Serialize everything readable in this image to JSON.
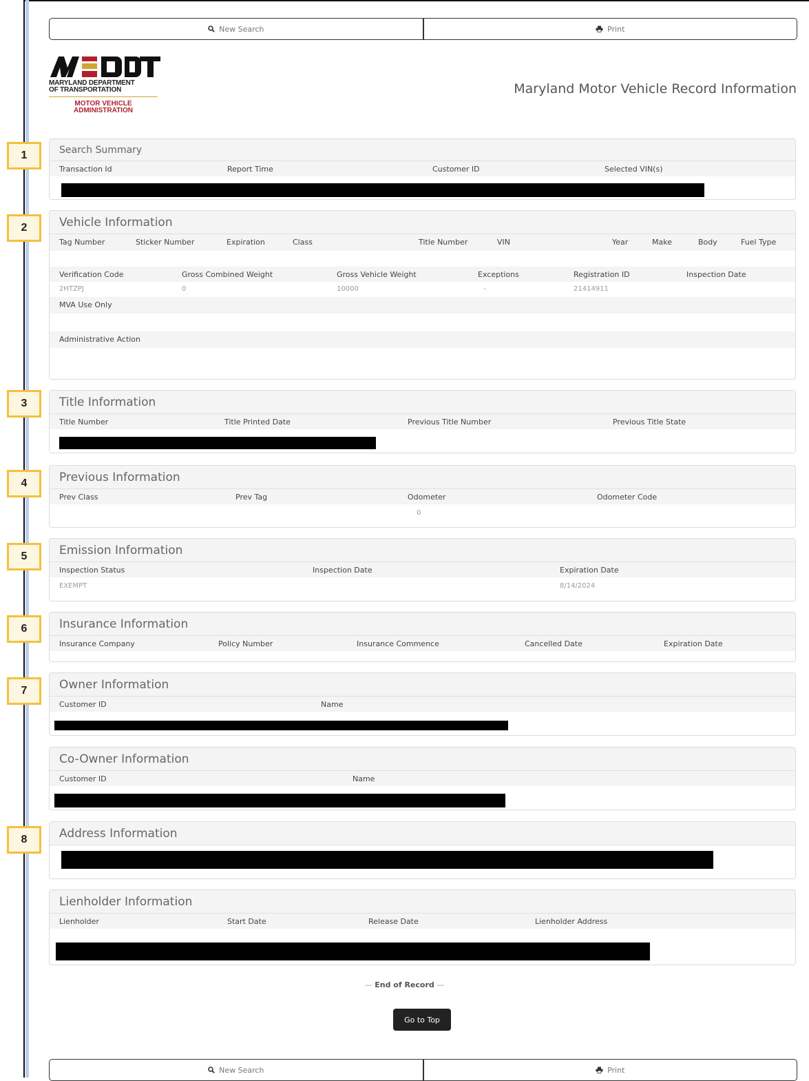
{
  "toolbar": {
    "new_search": "New Search",
    "print": "Print"
  },
  "logo": {
    "mark": "MDOT",
    "dept_line1": "MARYLAND DEPARTMENT",
    "dept_line2": "OF TRANSPORTATION",
    "mva_line1": "MOTOR VEHICLE",
    "mva_line2": "ADMINISTRATION"
  },
  "page_title": "Maryland Motor Vehicle Record Information",
  "badges": [
    "1",
    "2",
    "3",
    "4",
    "5",
    "6",
    "7",
    "8"
  ],
  "search_summary": {
    "title": "Search Summary",
    "headers": [
      "Transaction Id",
      "Report Time",
      "Customer ID",
      "Selected VIN(s)"
    ]
  },
  "vehicle": {
    "title": "Vehicle Information",
    "headers1": [
      "Tag Number",
      "Sticker Number",
      "Expiration",
      "Class",
      "Title Number",
      "VIN",
      "Year",
      "Make",
      "Body",
      "Fuel Type"
    ],
    "headers2": [
      "Verification Code",
      "Gross Combined Weight",
      "Gross Vehicle Weight",
      "Exceptions",
      "Registration ID",
      "Inspection Date"
    ],
    "values2": [
      "2HTZPJ",
      "0",
      "10000",
      "-",
      "21414911",
      ""
    ],
    "mva_use_only": "MVA Use Only",
    "admin_action": "Administrative Action"
  },
  "title_info": {
    "title": "Title Information",
    "headers": [
      "Title Number",
      "Title Printed Date",
      "Previous Title Number",
      "Previous Title State"
    ]
  },
  "previous": {
    "title": "Previous Information",
    "headers": [
      "Prev Class",
      "Prev Tag",
      "Odometer",
      "Odometer Code"
    ],
    "odometer": "0"
  },
  "emission": {
    "title": "Emission Information",
    "headers": [
      "Inspection Status",
      "Inspection Date",
      "Expiration Date"
    ],
    "inspection_status": "EXEMPT",
    "expiration_date": "8/14/2024"
  },
  "insurance": {
    "title": "Insurance Information",
    "headers": [
      "Insurance Company",
      "Policy Number",
      "Insurance Commence",
      "Cancelled Date",
      "Expiration Date"
    ]
  },
  "owner": {
    "title": "Owner Information",
    "headers": [
      "Customer ID",
      "Name"
    ]
  },
  "coowner": {
    "title": "Co-Owner Information",
    "headers": [
      "Customer ID",
      "Name"
    ]
  },
  "address": {
    "title": "Address Information"
  },
  "lienholder": {
    "title": "Lienholder Information",
    "headers": [
      "Lienholder",
      "Start Date",
      "Release Date",
      "Lienholder Address"
    ]
  },
  "end_of_record": "End of Record",
  "go_to_top": "Go to Top",
  "colors": {
    "badge_border": "#f2c13c",
    "mva_red": "#b11f2e",
    "mdot_gold": "#d1a531"
  }
}
